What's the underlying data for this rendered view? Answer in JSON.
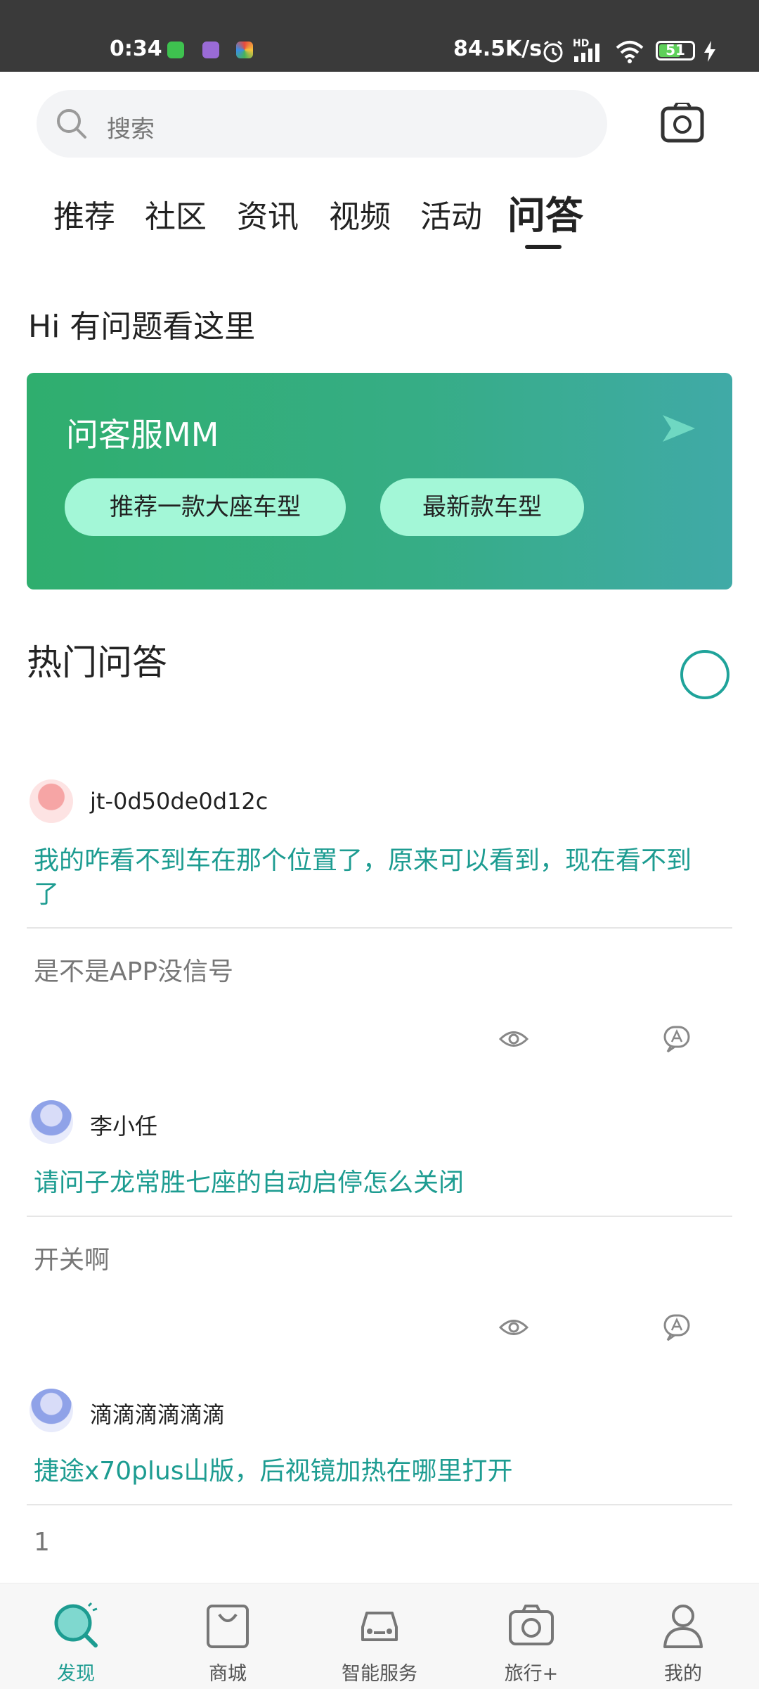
{
  "status_bar": {
    "time": "0:34",
    "speed": "84.5K/s",
    "hd": "HD",
    "battery": "51"
  },
  "search": {
    "placeholder": "搜索"
  },
  "tabs": [
    {
      "label": "推荐"
    },
    {
      "label": "社区"
    },
    {
      "label": "资讯"
    },
    {
      "label": "视频"
    },
    {
      "label": "活动"
    },
    {
      "label": "问答",
      "active": true
    }
  ],
  "greeting": "Hi 有问题看这里",
  "banner": {
    "title": "问客服MM",
    "chips": [
      "推荐一款大座车型",
      "最新款车型"
    ]
  },
  "hot_title": "热门问答",
  "posts": [
    {
      "username": "jt-0d50de0d12c",
      "question": "我的咋看不到车在那个位置了，原来可以看到，现在看不到了",
      "answer": "是不是APP没信号"
    },
    {
      "username": "李小任",
      "question": "请问子龙常胜七座的自动启停怎么关闭",
      "answer": "开关啊"
    },
    {
      "username": "滴滴滴滴滴滴",
      "question": "捷途x70plus山版，后视镜加热在哪里打开",
      "answer": "1"
    }
  ],
  "bottom_nav": [
    {
      "label": "发现",
      "icon": "discover-icon",
      "active": true
    },
    {
      "label": "商城",
      "icon": "mall-bag-icon"
    },
    {
      "label": "智能服务",
      "icon": "car-service-icon"
    },
    {
      "label": "旅行+",
      "icon": "travel-camera-icon"
    },
    {
      "label": "我的",
      "icon": "profile-icon"
    }
  ],
  "colors": {
    "accent": "#1d9c91",
    "banner_start": "#2fae6e",
    "banner_end": "#40aaa7",
    "chip": "#a3f7d7"
  }
}
